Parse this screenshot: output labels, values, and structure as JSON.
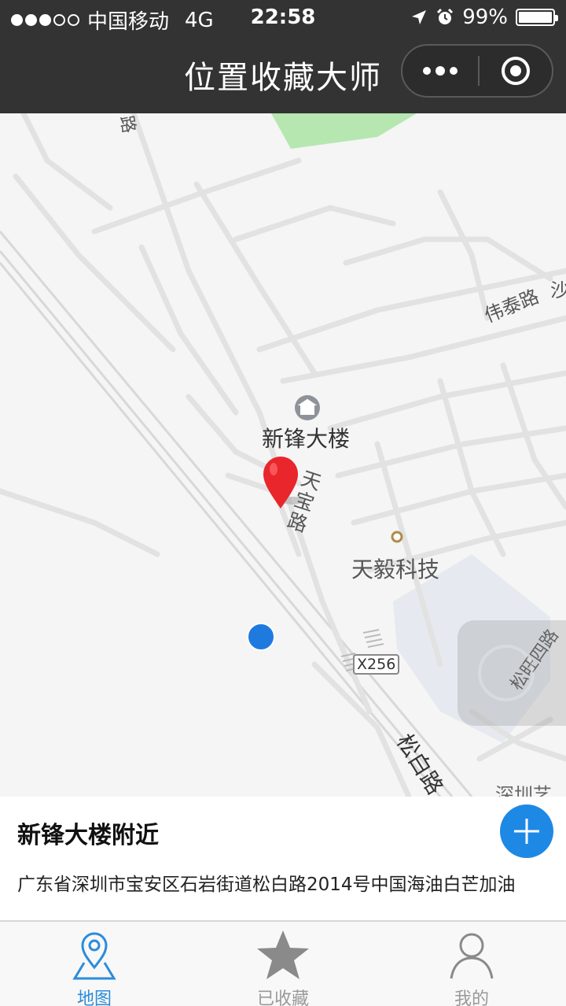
{
  "status_bar": {
    "carrier": "中国移动",
    "network": "4G",
    "time": "22:58",
    "battery": "99%",
    "battery_level": 0.99,
    "signal_bars_filled": 3,
    "signal_bars_total": 5
  },
  "header": {
    "title": "位置收藏大师"
  },
  "map": {
    "labels": {
      "building": "新锋大楼",
      "tianyi": "天毅科技",
      "tianbao_road": "天宝路",
      "weitai_road": "伟泰路",
      "sha": "沙",
      "songbai_road": "松白路",
      "songwang_road": "松旺四路",
      "shenzhen": "深圳艺",
      "road_top": "路",
      "x256": "X256"
    }
  },
  "info": {
    "title": "新锋大楼附近",
    "address": "广东省深圳市宝安区石岩街道松白路2014号中国海油白芒加油"
  },
  "tabs": [
    {
      "label": "地图",
      "icon": "map-pin-icon",
      "active": true
    },
    {
      "label": "已收藏",
      "icon": "star-icon",
      "active": false
    },
    {
      "label": "我的",
      "icon": "user-icon",
      "active": false
    }
  ],
  "colors": {
    "header_bg": "#333333",
    "accent": "#2a8cdb",
    "add_button": "#1e88e5",
    "pin_red": "#e8262b",
    "location_dot": "#1f7ae0",
    "park_green": "#b6e7b0"
  }
}
